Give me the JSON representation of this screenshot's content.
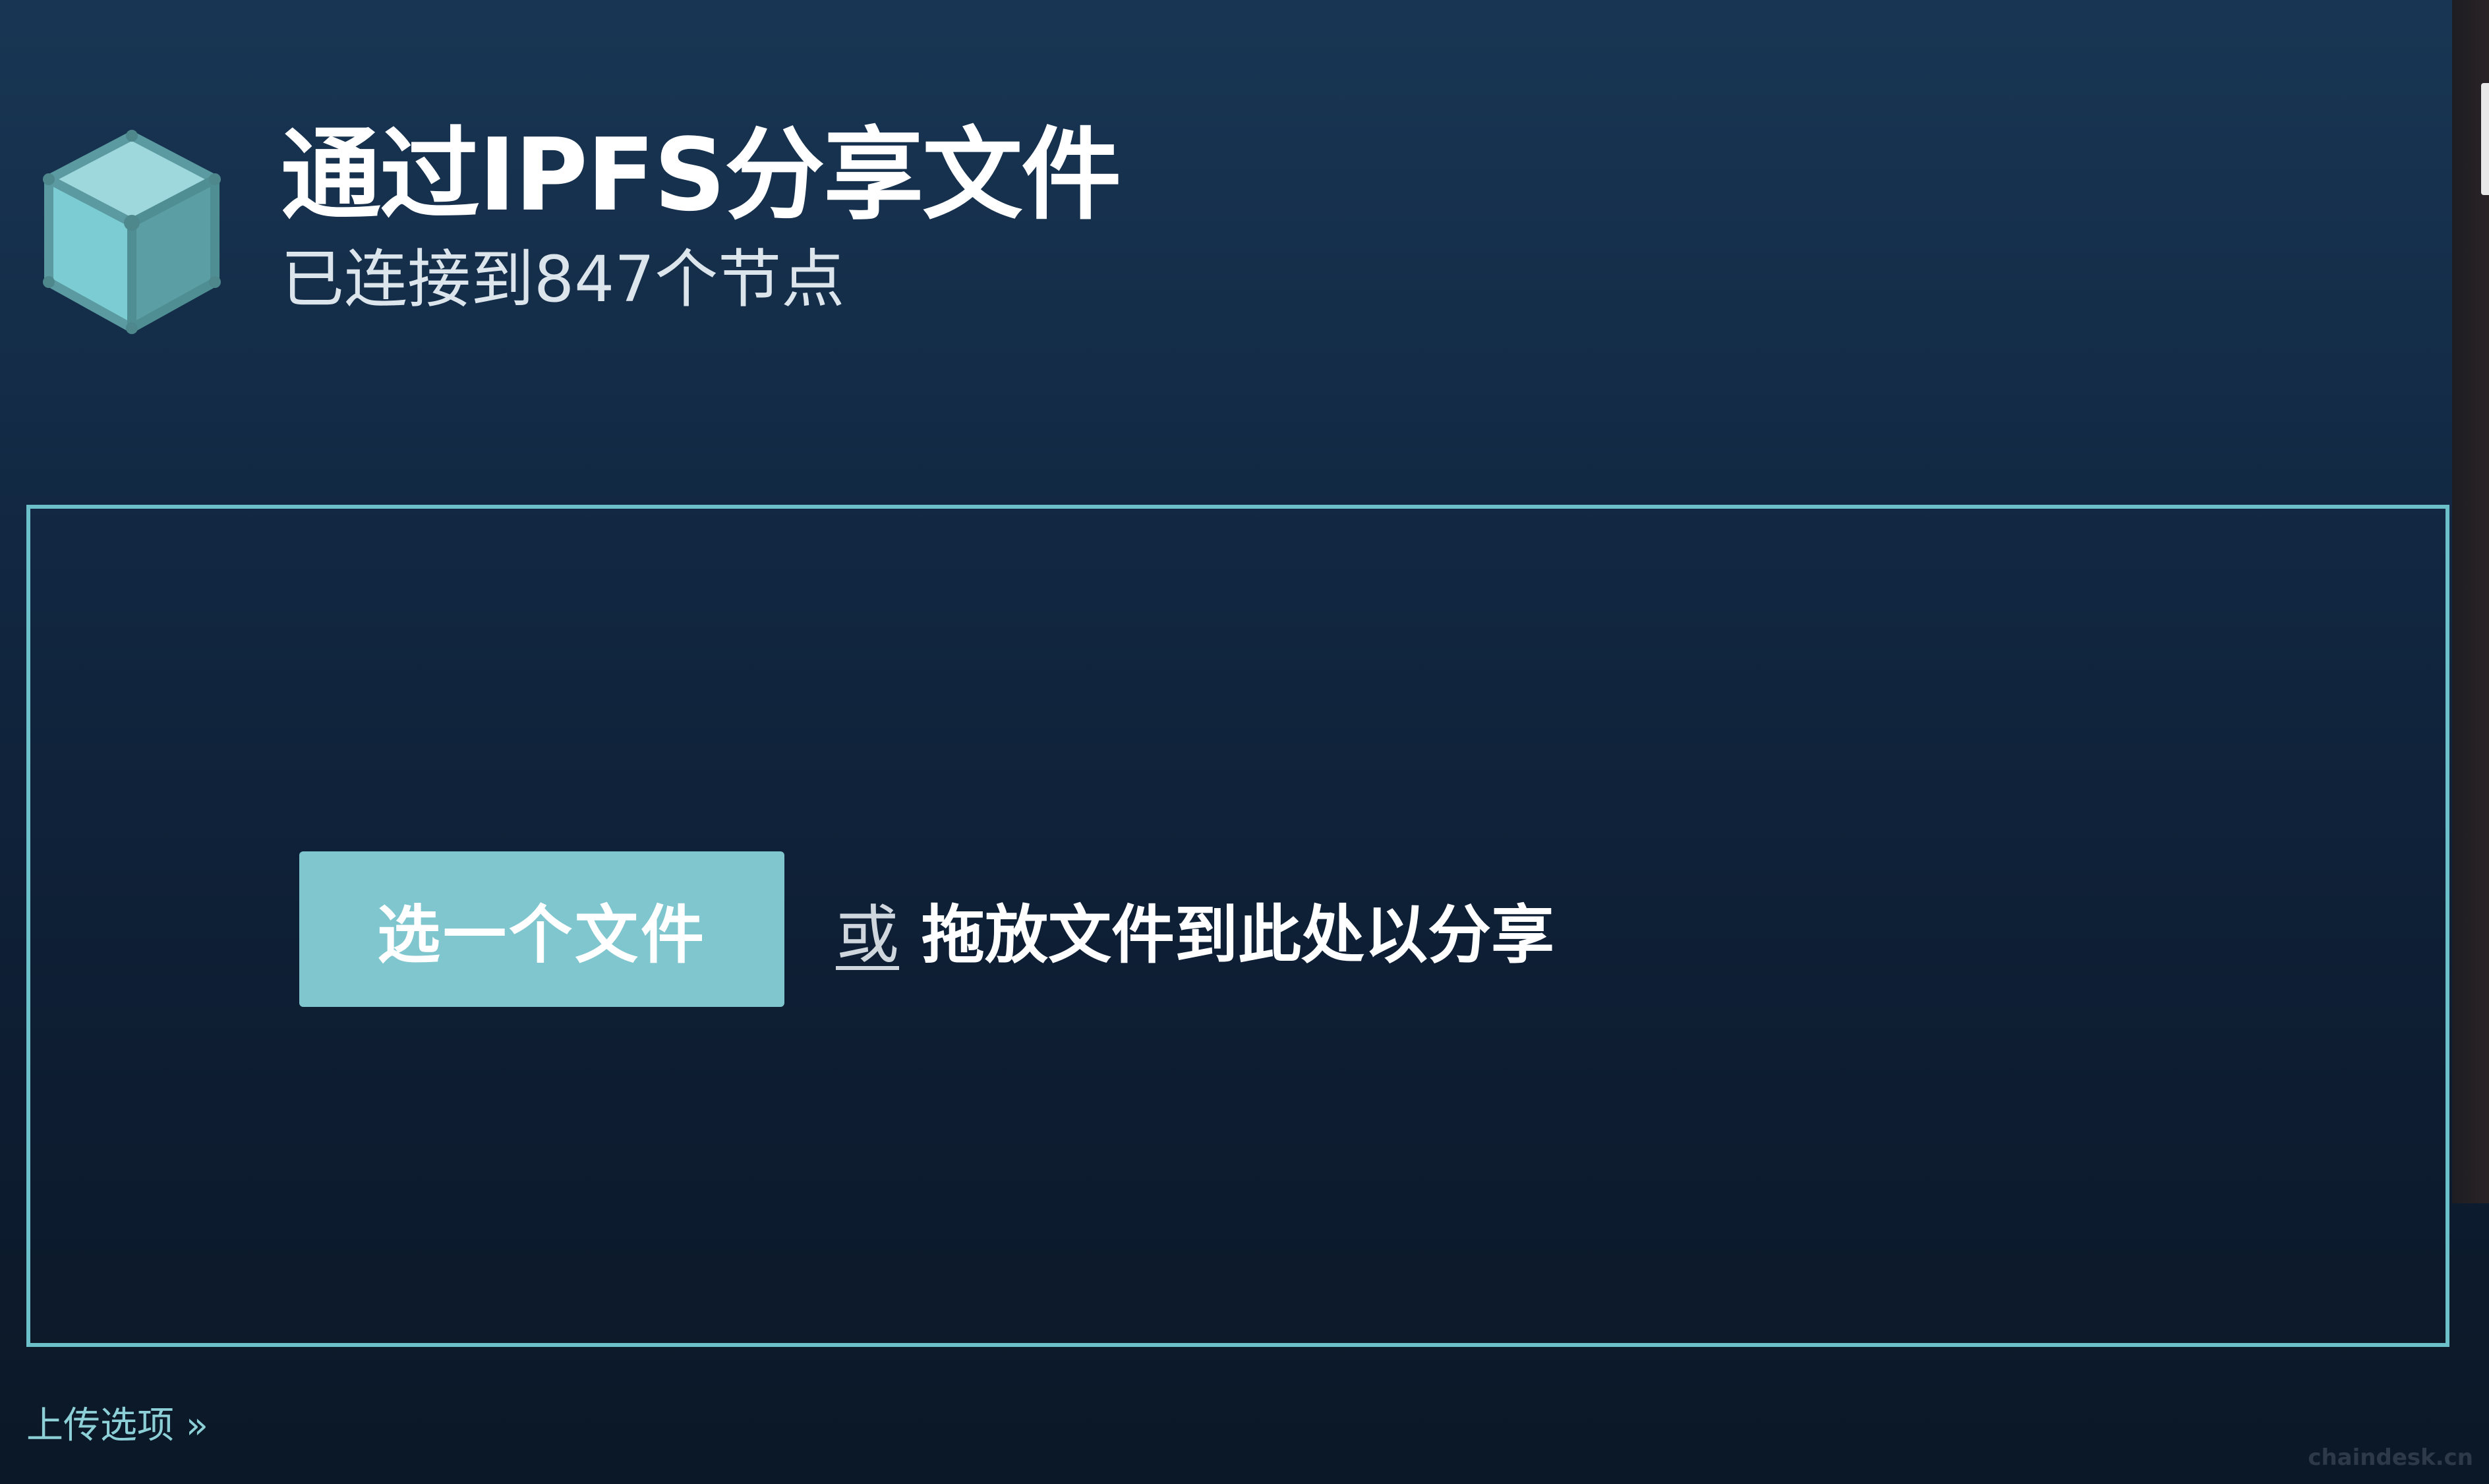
{
  "header": {
    "title": "通过IPFS分享文件",
    "subtitle": "已连接到847个节点"
  },
  "upload": {
    "choose_button_label": "选一个文件",
    "or_label": "或",
    "drop_label": "拖放文件到此处以分享"
  },
  "options_link": "上传选项 »",
  "watermark": "chaindesk.cn",
  "icons": {
    "logo": "cube-logo-icon"
  },
  "colors": {
    "accent": "#6cc0c9",
    "button": "#7fc6cf",
    "background_top": "#183654",
    "background_bottom": "#0b1827",
    "link": "#8ccfd6"
  }
}
